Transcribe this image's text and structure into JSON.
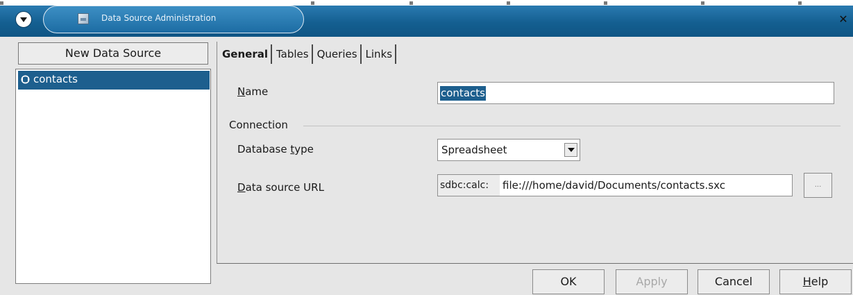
{
  "window": {
    "title": "Data Source Administration"
  },
  "left_panel": {
    "new_button_label": "New Data Source",
    "items": [
      {
        "label": "contacts",
        "selected": true
      }
    ]
  },
  "tabs": [
    {
      "label": "General",
      "active": true
    },
    {
      "label": "Tables",
      "active": false
    },
    {
      "label": "Queries",
      "active": false
    },
    {
      "label": "Links",
      "active": false
    }
  ],
  "general": {
    "name_label_mnemonic": "N",
    "name_label_rest": "ame",
    "name_value": "contacts",
    "connection_group": "Connection",
    "db_type_label_a": "Database ",
    "db_type_label_mnemonic": "t",
    "db_type_label_b": "ype",
    "db_type_value": "Spreadsheet",
    "url_label_mnemonic": "D",
    "url_label_rest": "ata source URL",
    "url_prefix": "sdbc:calc:",
    "url_value": "file:///home/david/Documents/contacts.sxc",
    "browse_label": "..."
  },
  "buttons": {
    "ok": "OK",
    "apply": "Apply",
    "cancel": "Cancel",
    "help_mnemonic": "H",
    "help_rest": "elp"
  },
  "colors": {
    "titlebar": "#145f91",
    "selection": "#1d5f8e"
  },
  "icons": {
    "menu": "window-menu-icon",
    "app": "data-source-icon",
    "close": "close-icon",
    "database": "database-icon"
  }
}
